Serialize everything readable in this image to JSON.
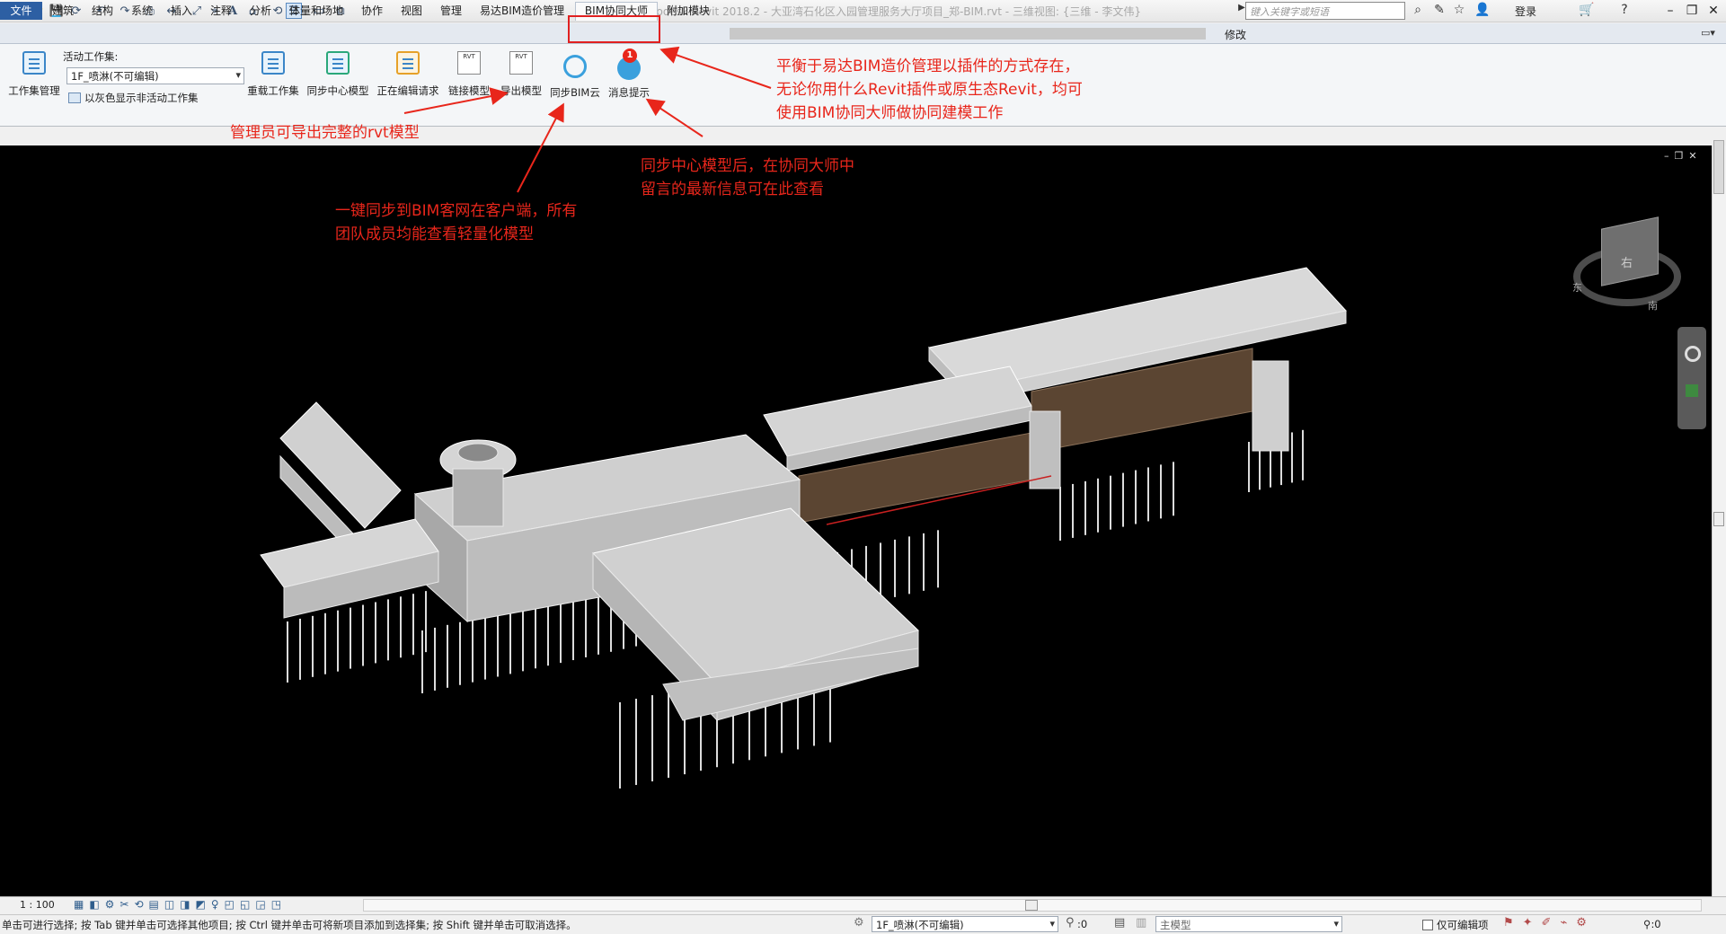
{
  "app": {
    "logo_letter": "R",
    "window_title": "Autodesk Revit 2018.2 -     大亚湾石化区入园管理服务大厅项目_郑-BIM.rvt - 三维视图: {三维 - 李文伟}",
    "search_placeholder": "键入关键字或短语",
    "login_label": "登录",
    "window_buttons": [
      "–",
      "❐",
      "✕"
    ]
  },
  "quick_access_icons": [
    "open-icon",
    "save-icon",
    "sync-icon",
    "undo-icon",
    "redo-icon",
    "print-icon",
    "measure-icon",
    "dimension-icon",
    "tag-icon",
    "text-icon",
    "3d-view-icon",
    "section-icon",
    "thin-lines-icon",
    "close-hidden-icon",
    "switch-windows-icon"
  ],
  "tabs": [
    "文件",
    "建筑",
    "结构",
    "系统",
    "插入",
    "注释",
    "分析",
    "体量和场地",
    "协作",
    "视图",
    "管理",
    "易达BIM造价管理",
    "BIM协同大师",
    "附加模块"
  ],
  "active_tab": "BIM协同大师",
  "modify_label": "修改",
  "ribbon": {
    "active_workset_label": "活动工作集:",
    "workset_value": "1F_喷淋(不可编辑)",
    "gray_inactive_label": "以灰色显示非活动工作集",
    "buttons": [
      "工作集管理",
      "重载工作集",
      "同步中心模型",
      "正在编辑请求",
      "链接模型",
      "导出模型",
      "同步BIM云",
      "消息提示"
    ],
    "rvt_icon_text": "RVT",
    "message_badge": "1"
  },
  "annotations": {
    "plugin_note": [
      "平衡于易达BIM造价管理以插件的方式存在，",
      "无论你用什么Revit插件或原生态Revit，均可",
      "使用BIM协同大师做协同建模工作"
    ],
    "export_note": "管理员可导出完整的rvt模型",
    "message_note": [
      "同步中心模型后，在协同大师中",
      "留言的最新信息可在此查看"
    ],
    "cloud_note": [
      "一键同步到BIM客网在客户端，所有",
      "团队成员均能查看轻量化模型"
    ],
    "color": "#e8261b"
  },
  "viewport": {
    "background": "#000000",
    "view_controls": [
      "–",
      "❐",
      "✕"
    ],
    "viewcube_face": "右",
    "viewcube_ring_labels": [
      "东",
      "南"
    ]
  },
  "view_control_bar": {
    "scale": "1 : 100"
  },
  "status_bar": {
    "hint": "单击可进行选择; 按 Tab 键并单击可选择其他项目; 按 Ctrl 键并单击可将新项目添加到选择集; 按 Shift 键并单击可取消选择。",
    "workset": "1F_喷淋(不可编辑)",
    "count": ":0",
    "model": "主模型",
    "editable_only": "仅可编辑项",
    "filter_count": ":0"
  }
}
